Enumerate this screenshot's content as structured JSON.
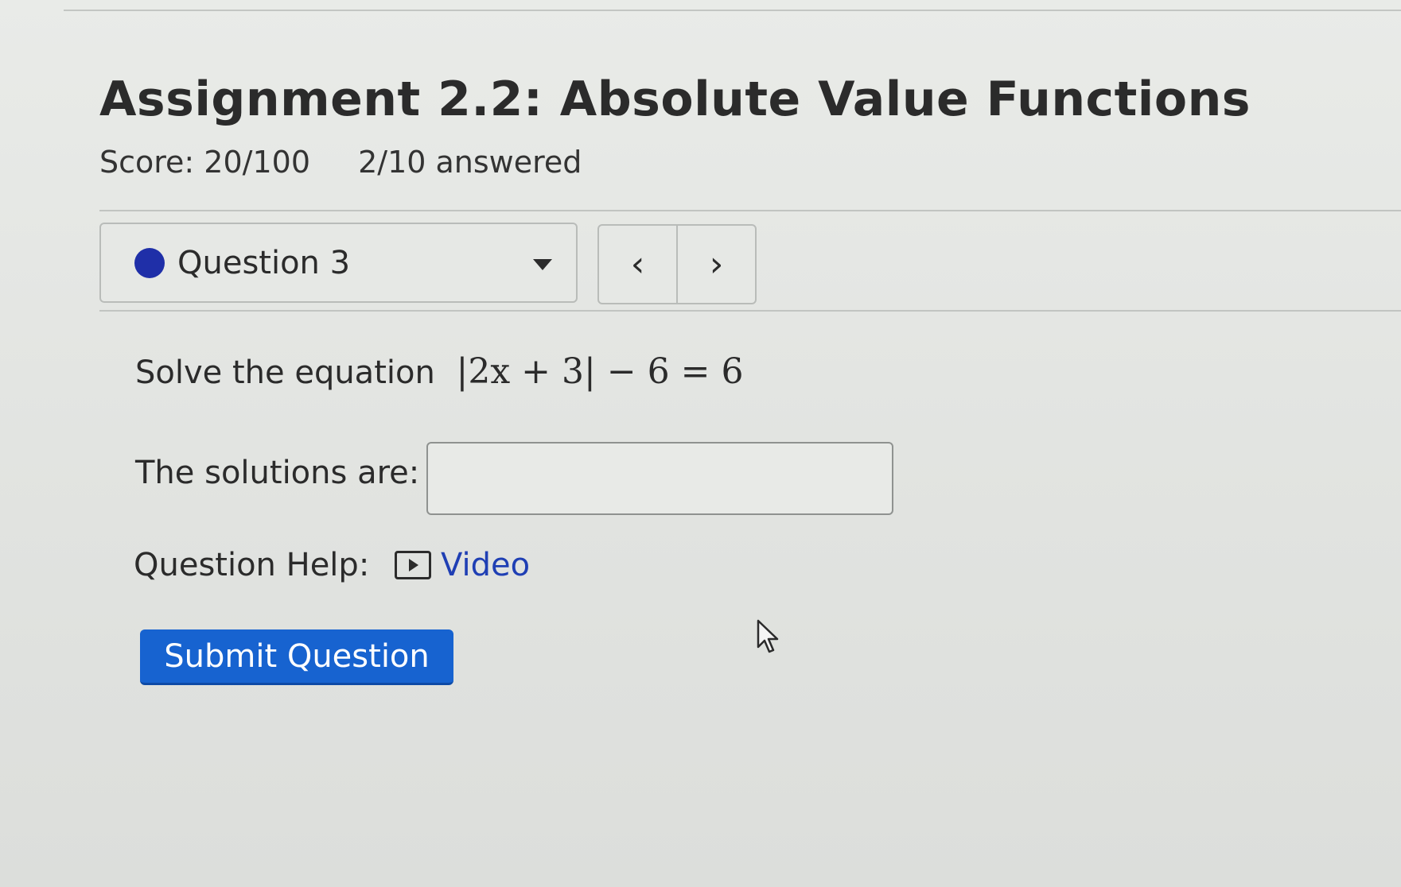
{
  "assignment": {
    "title": "Assignment 2.2: Absolute Value Functions",
    "score": "Score: 20/100",
    "progress": "2/10 answered"
  },
  "question_nav": {
    "selected_label": "Question 3",
    "status_icon": "filled-dot-icon",
    "status_color": "#1f2fa8",
    "prev_glyph": "‹",
    "next_glyph": "›"
  },
  "question": {
    "prompt": "Solve the equation",
    "equation": "|2x + 3| − 6 = 6",
    "solutions_label": "The solutions are:",
    "answer_value": "",
    "help_label": "Question Help:",
    "help_link": "Video"
  },
  "actions": {
    "submit_label": "Submit Question",
    "submit_color": "#1763d0"
  }
}
